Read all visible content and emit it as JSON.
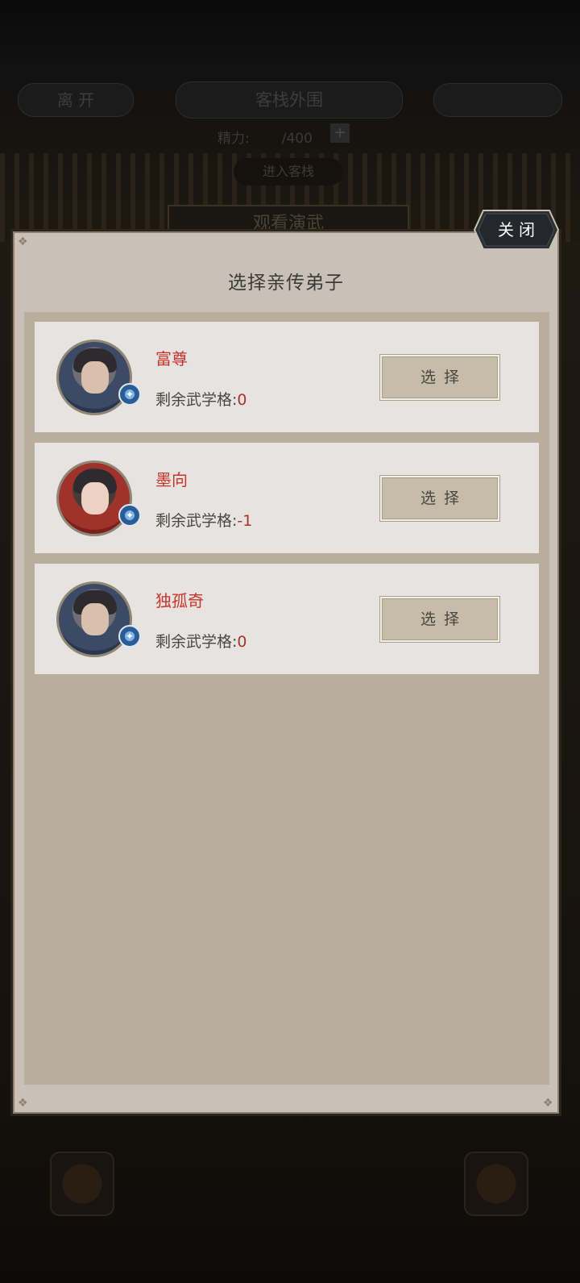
{
  "background": {
    "leave_label": "离 开",
    "location_title": "客栈外围",
    "energy_label": "精力:",
    "energy_value": "/400",
    "enter_label": "进入客栈",
    "watch_label": "观看演武"
  },
  "dialog": {
    "title": "选择亲传弟子",
    "close_label": "关闭",
    "select_label": "选择",
    "remaining_label": "剩余武学格:",
    "disciples": [
      {
        "name": "富尊",
        "remaining": "0"
      },
      {
        "name": "墨向",
        "remaining": "-1"
      },
      {
        "name": "独孤奇",
        "remaining": "0"
      }
    ]
  }
}
